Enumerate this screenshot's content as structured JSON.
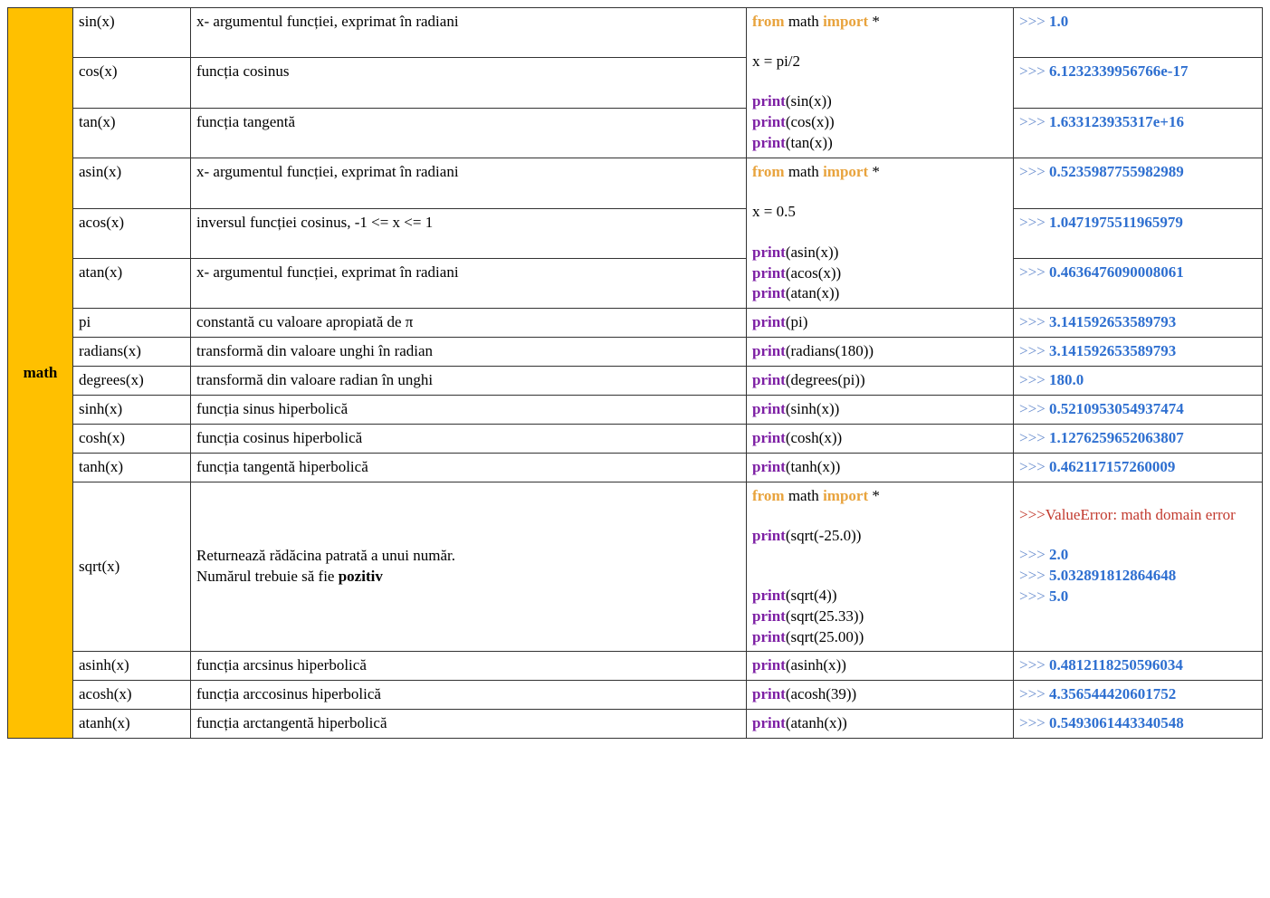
{
  "module": "math",
  "rows": {
    "sin": {
      "func": "sin(x)",
      "desc": "x- argumentul funcției, exprimat în radiani"
    },
    "cos": {
      "func": "cos(x)",
      "desc": "funcția cosinus"
    },
    "tan": {
      "func": "tan(x)",
      "desc": "funcția tangentă"
    },
    "asin": {
      "func": "asin(x)",
      "desc": "x- argumentul funcției, exprimat în radiani"
    },
    "acos": {
      "func": "acos(x)",
      "desc": "inversul funcției cosinus, -1 <= x <= 1"
    },
    "atan": {
      "func": "atan(x)",
      "desc": "x- argumentul funcției, exprimat în radiani"
    },
    "pi": {
      "func": "pi",
      "desc": "constantă cu valoare apropiată de π"
    },
    "radians": {
      "func": "radians(x)",
      "desc": "transformă din valoare unghi în radian"
    },
    "degrees": {
      "func": "degrees(x)",
      "desc": "transformă din valoare radian în unghi"
    },
    "sinh": {
      "func": "sinh(x)",
      "desc": "funcția sinus hiperbolică"
    },
    "cosh": {
      "func": "cosh(x)",
      "desc": "funcția cosinus hiperbolică"
    },
    "tanh": {
      "func": "tanh(x)",
      "desc": "funcția tangentă hiperbolică"
    },
    "sqrt": {
      "func": "sqrt(x)",
      "desc1": "Returnează rădăcina patrată a unui număr.",
      "desc2a": "Numărul trebuie să fie ",
      "desc2b": "pozitiv"
    },
    "asinh": {
      "func": "asinh(x)",
      "desc": "funcția arcsinus hiperbolică"
    },
    "acosh": {
      "func": "acosh(x)",
      "desc": "funcția arccosinus hiperbolică"
    },
    "atanh": {
      "func": "atanh(x)",
      "desc": "funcția arctangentă hiperbolică"
    }
  },
  "code": {
    "from": "from",
    "math": " math ",
    "import": "import",
    "star": " *",
    "xpi2": "x = pi/2",
    "x05": "x = 0.5",
    "print": "print",
    "p_sin": "(sin(x))",
    "p_cos": "(cos(x))",
    "p_tan": "(tan(x))",
    "p_asin": "(asin(x))",
    "p_acos": "(acos(x))",
    "p_atan": "(atan(x))",
    "p_pi": "(pi)",
    "p_radians": "(radians(180))",
    "p_degrees": "(degrees(pi))",
    "p_sinh": "(sinh(x))",
    "p_cosh": "(cosh(x))",
    "p_tanh": "(tanh(x))",
    "p_sqrt_neg": "(sqrt(-25.0))",
    "p_sqrt4": "(sqrt(4))",
    "p_sqrt2533": "(sqrt(25.33))",
    "p_sqrt2500": "(sqrt(25.00))",
    "p_asinh": "(asinh(x))",
    "p_acosh": "(acosh(39))",
    "p_atanh": "(atanh(x))"
  },
  "out": {
    "prompt": ">>> ",
    "promptNoSpace": ">>>",
    "sin": "1.0",
    "cos": "6.1232339956766e-17",
    "tan": "1.633123935317e+16",
    "asin": "0.5235987755982989",
    "acos": "1.0471975511965979",
    "atan": "0.4636476090008061",
    "pi": "3.141592653589793",
    "radians": "3.141592653589793",
    "degrees": "180.0",
    "sinh": "0.5210953054937474",
    "cosh": "1.1276259652063807",
    "tanh": "0.462117157260009",
    "sqrt_err": "ValueError: math domain error",
    "sqrt4": "2.0",
    "sqrt2533": "5.032891812864648",
    "sqrt2500": "5.0",
    "asinh": "0.4812118250596034",
    "acosh": "4.356544420601752",
    "atanh": "0.5493061443340548"
  }
}
